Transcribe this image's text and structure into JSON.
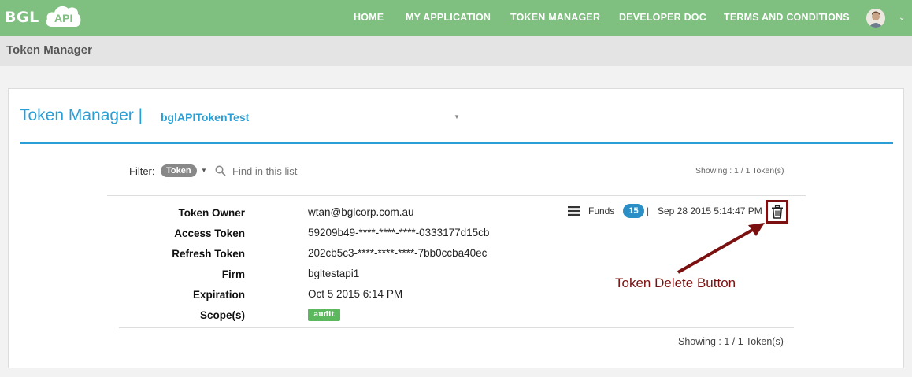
{
  "brand": {
    "name": "BGL",
    "cloud_label": "API"
  },
  "nav": {
    "items": [
      {
        "label": "HOME",
        "active": false
      },
      {
        "label": "MY APPLICATION",
        "active": false
      },
      {
        "label": "TOKEN MANAGER",
        "active": true
      },
      {
        "label": "DEVELOPER DOC",
        "active": false
      },
      {
        "label": "TERMS AND CONDITIONS",
        "active": false
      }
    ],
    "avatar_icon": "user-avatar",
    "dropdown_icon": "chevron-down-icon"
  },
  "page": {
    "title": "Token Manager"
  },
  "card": {
    "title": "Token Manager |",
    "app_select": {
      "selected": "bglAPITokenTest"
    },
    "filter": {
      "label": "Filter:",
      "pill": "Token",
      "search_placeholder": "Find in this list"
    },
    "showing_top": "Showing : 1 / 1 Token(s)",
    "showing_bottom": "Showing : 1 / 1 Token(s)",
    "token": {
      "fields": [
        {
          "label": "Token Owner",
          "value": "wtan@bglcorp.com.au"
        },
        {
          "label": "Access Token",
          "value": "59209b49-****-****-****-0333177d15cb"
        },
        {
          "label": "Refresh Token",
          "value": "202cb5c3-****-****-****-7bb0ccba40ec"
        },
        {
          "label": "Firm",
          "value": "bgltestapi1"
        },
        {
          "label": "Expiration",
          "value": "Oct 5 2015 6:14 PM"
        },
        {
          "label": "Scope(s)",
          "value": "audit"
        }
      ],
      "funds_label": "Funds",
      "funds_count": "15",
      "separator": "|",
      "created": "Sep 28 2015 5:14:47 PM"
    },
    "annotation": "Token Delete Button"
  },
  "colors": {
    "nav_bg": "#7fbf80",
    "accent_blue": "#2a9fd6",
    "scope_green": "#5cb85c",
    "annotation_red": "#7b1010"
  }
}
